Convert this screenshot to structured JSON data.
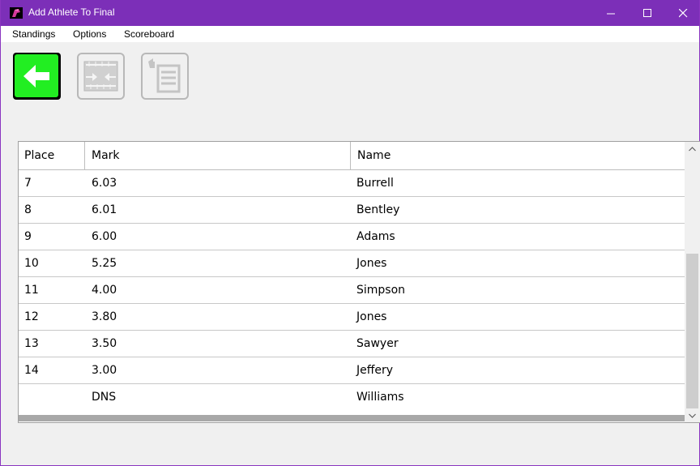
{
  "window": {
    "title": "Add Athlete To Final",
    "accent_color": "#7c2fb8"
  },
  "menu": {
    "items": [
      "Standings",
      "Options",
      "Scoreboard"
    ]
  },
  "toolbar": {
    "buttons": [
      {
        "icon": "back-arrow-icon",
        "enabled": true,
        "color": "#22ee22"
      },
      {
        "icon": "measure-ruler-icon",
        "enabled": false
      },
      {
        "icon": "report-list-icon",
        "enabled": false
      }
    ]
  },
  "grid": {
    "columns": [
      "Place",
      "Mark",
      "Name"
    ],
    "rows": [
      {
        "place": "7",
        "mark": "6.03",
        "name": "Burrell"
      },
      {
        "place": "8",
        "mark": "6.01",
        "name": "Bentley"
      },
      {
        "place": "9",
        "mark": "6.00",
        "name": "Adams"
      },
      {
        "place": "10",
        "mark": "5.25",
        "name": "Jones"
      },
      {
        "place": "11",
        "mark": "4.00",
        "name": "Simpson"
      },
      {
        "place": "12",
        "mark": "3.80",
        "name": "Jones"
      },
      {
        "place": "13",
        "mark": "3.50",
        "name": "Sawyer"
      },
      {
        "place": "14",
        "mark": "3.00",
        "name": "Jeffery"
      },
      {
        "place": "",
        "mark": "DNS",
        "name": "Williams"
      }
    ]
  }
}
